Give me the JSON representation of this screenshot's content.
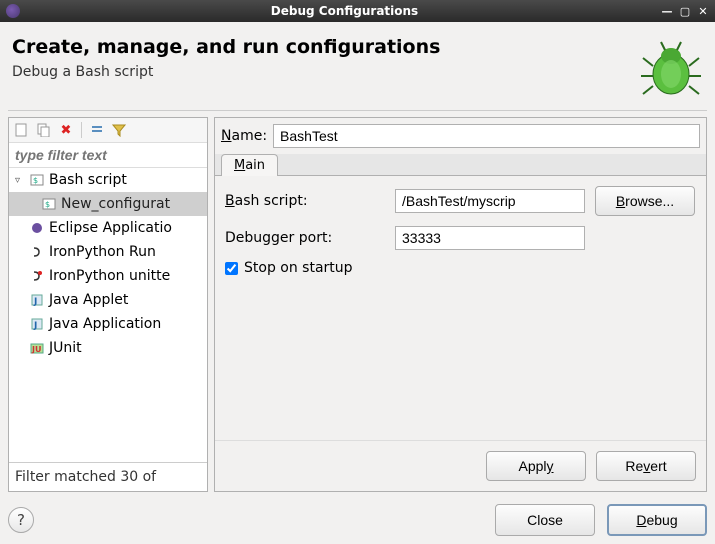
{
  "window": {
    "title": "Debug Configurations"
  },
  "header": {
    "title": "Create, manage, and run configurations",
    "subtitle": "Debug a Bash script"
  },
  "left": {
    "filter_placeholder": "type filter text",
    "tree": {
      "root": "Bash script",
      "selected": "New_configurat",
      "items": [
        "Eclipse Applicatio",
        "IronPython Run",
        "IronPython unitte",
        "Java Applet",
        "Java Application",
        "JUnit"
      ]
    },
    "filter_status": "Filter matched 30 of"
  },
  "form": {
    "name_label": "Name:",
    "name_value": "BashTest",
    "tab": "Main",
    "bash_script_label": "Bash script:",
    "bash_script_value": "/BashTest/myscrip",
    "browse_label": "Browse...",
    "debugger_port_label": "Debugger port:",
    "debugger_port_value": "33333",
    "stop_on_startup_label": "Stop on startup",
    "stop_on_startup_checked": true,
    "apply_label": "Apply",
    "revert_label": "Revert"
  },
  "footer": {
    "close_label": "Close",
    "debug_label": "Debug"
  }
}
